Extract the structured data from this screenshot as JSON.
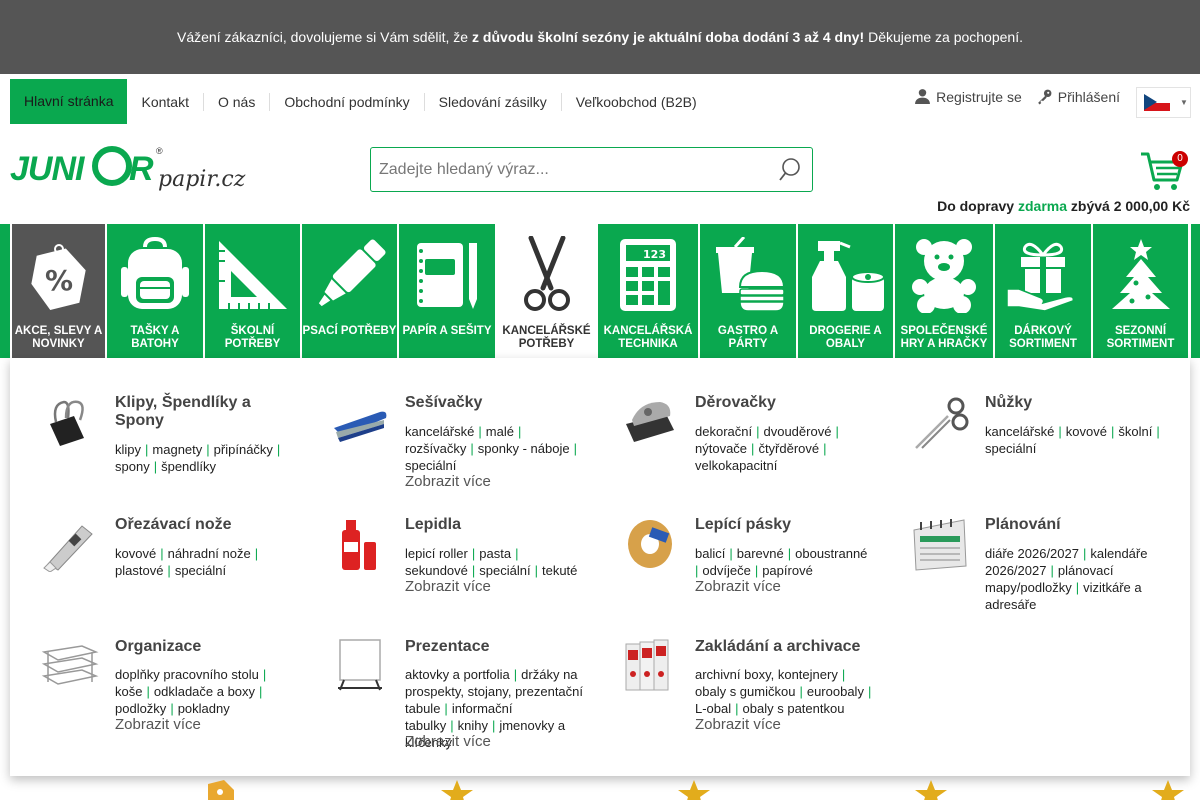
{
  "notice": {
    "pre": "Vážení zákazníci, dovolujeme si Vám sdělit, že ",
    "bold": "z důvodu školní sezóny je aktuální doba dodání 3 až 4 dny!",
    "post": " Děkujeme za pochopení."
  },
  "topnav": {
    "links": [
      "Hlavní stránka",
      "Kontakt",
      "O nás",
      "Obchodní podmínky",
      "Sledování zásilky",
      "Veľkoobchod (B2B)"
    ],
    "register": "Registrujte se",
    "login": "Přihlášení"
  },
  "search": {
    "placeholder": "Zadejte hledaný výraz..."
  },
  "cart": {
    "count": "0"
  },
  "shipping": {
    "pre": "Do dopravy ",
    "free": "zdarma",
    "post": " zbývá 2 000,00 Kč"
  },
  "logo": {
    "text1": "JUNIOR",
    "text2": "papir.cz"
  },
  "categories": [
    {
      "label": "AKCE, SLEVY A NOVINKY",
      "icon": "percent-tag-icon"
    },
    {
      "label": "TAŠKY A BATOHY",
      "icon": "backpack-icon"
    },
    {
      "label": "ŠKOLNÍ POTŘEBY",
      "icon": "set-square-icon"
    },
    {
      "label": "PSACÍ POTŘEBY",
      "icon": "highlighter-icon"
    },
    {
      "label": "PAPÍR A SEŠITY",
      "icon": "notebook-icon"
    },
    {
      "label": "KANCELÁŘSKÉ POTŘEBY",
      "icon": "scissors-icon"
    },
    {
      "label": "KANCELÁŘSKÁ TECHNIKA",
      "icon": "calculator-icon"
    },
    {
      "label": "GASTRO A PÁRTY",
      "icon": "burger-drink-icon"
    },
    {
      "label": "DROGERIE A OBALY",
      "icon": "spray-bottle-icon"
    },
    {
      "label": "SPOLEČENSKÉ HRY A HRAČKY",
      "icon": "teddy-bear-icon"
    },
    {
      "label": "DÁRKOVÝ SORTIMENT",
      "icon": "gift-icon"
    },
    {
      "label": "SEZONNÍ SORTIMENT",
      "icon": "christmas-tree-icon"
    }
  ],
  "mega": [
    {
      "title": "Klipy, Špendlíky a Spony",
      "subs": [
        "klipy",
        "magnety",
        "připínáčky",
        "spony",
        "špendlíky"
      ],
      "more": ""
    },
    {
      "title": "Sešívačky",
      "subs": [
        "kancelářské",
        "malé",
        "rozšívačky",
        "sponky - náboje",
        "speciální"
      ],
      "more": "Zobrazit více"
    },
    {
      "title": "Děrovačky",
      "subs": [
        "dekorační",
        "dvouděrové",
        "nýtovače",
        "čtyřděrové",
        "velkokapacitní"
      ],
      "more": ""
    },
    {
      "title": "Nůžky",
      "subs": [
        "kancelářské",
        "kovové",
        "školní",
        "speciální"
      ],
      "more": ""
    },
    {
      "title": "Ořezávací nože",
      "subs": [
        "kovové",
        "náhradní nože",
        "plastové",
        "speciální"
      ],
      "more": ""
    },
    {
      "title": "Lepidla",
      "subs": [
        "lepicí roller",
        "pasta",
        "sekundové",
        "speciální",
        "tekuté"
      ],
      "more": "Zobrazit více"
    },
    {
      "title": "Lepící pásky",
      "subs": [
        "balicí",
        "barevné",
        "oboustranné",
        "odvíječe",
        "papírové"
      ],
      "more": "Zobrazit více"
    },
    {
      "title": "Plánování",
      "subs": [
        "diáře 2026/2027",
        "kalendáře 2026/2027",
        "plánovací mapy/podložky",
        "vizitkáře a adresáře"
      ],
      "more": ""
    },
    {
      "title": "Organizace",
      "subs": [
        "doplňky pracovního stolu",
        "koše",
        "odkladače a boxy",
        "podložky",
        "pokladny"
      ],
      "more": "Zobrazit více"
    },
    {
      "title": "Prezentace",
      "subs": [
        "aktovky a portfolia",
        "držáky na prospekty, stojany, prezentační tabule",
        "informační tabulky",
        "knihy",
        "jmenovky a klíčenky"
      ],
      "more": "Zobrazit více"
    },
    {
      "title": "Zakládání a archivace",
      "subs": [
        "archivní boxy, kontejnery",
        "obaly s gumičkou",
        "euroobaly",
        "L-obal",
        "obaly s patentkou"
      ],
      "more": "Zobrazit více"
    }
  ],
  "colors": {
    "brand_green": "#0aa84f",
    "notice_bg": "#555555",
    "badge_red": "#cc0000"
  }
}
